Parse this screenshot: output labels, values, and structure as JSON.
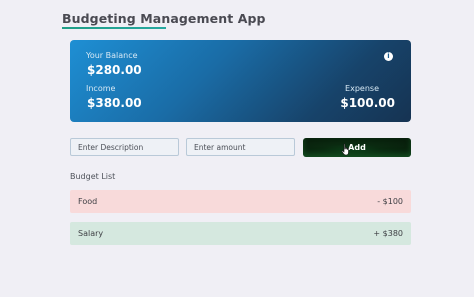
{
  "app": {
    "title": "Budgeting Management App"
  },
  "balance_card": {
    "balance_label": "Your Balance",
    "balance_value": "$280.00",
    "income_label": "Income",
    "income_value": "$380.00",
    "expense_label": "Expense",
    "expense_value": "$100.00",
    "info_icon": "info-icon"
  },
  "form": {
    "description_placeholder": "Enter Description",
    "amount_placeholder": "Enter amount",
    "add_label": "Add"
  },
  "budget_list": {
    "heading": "Budget List",
    "items": [
      {
        "name": "Food",
        "amount": "- $100",
        "type": "expense",
        "color": "#f8dada"
      },
      {
        "name": "Salary",
        "amount": "+ $380",
        "type": "income",
        "color": "#d5e8df"
      }
    ]
  },
  "colors": {
    "background": "#f0eff5",
    "accent": "#1f9e86",
    "card_gradient_start": "#1e8fd4",
    "card_gradient_end": "#163352",
    "add_button": "#0a2a10"
  }
}
